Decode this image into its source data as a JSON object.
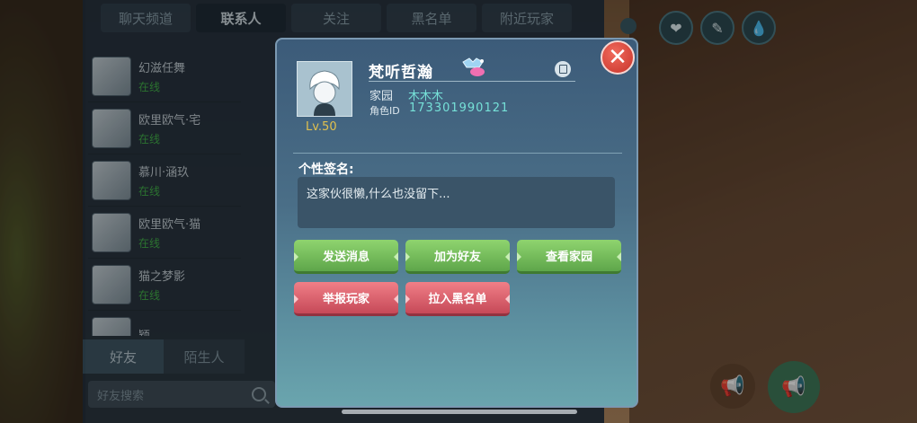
{
  "contacts_panel": {
    "top_tabs": [
      "聊天频道",
      "联系人",
      "关注",
      "黑名单",
      "附近玩家"
    ],
    "active_top_tab": 1,
    "friends": [
      {
        "name": "幻滋任舞",
        "status": "在线"
      },
      {
        "name": "欧里欧气·宅",
        "status": "在线"
      },
      {
        "name": "慕川·涵玖",
        "status": "在线"
      },
      {
        "name": "欧里欧气·猫",
        "status": "在线"
      },
      {
        "name": "猫之梦影",
        "status": "在线"
      },
      {
        "name": "颖",
        "status": ""
      }
    ],
    "bottom_tabs": [
      "好友",
      "陌生人"
    ],
    "search_placeholder": "好友搜索"
  },
  "profile": {
    "player_name": "梵听哲瀚",
    "level": "Lv.50",
    "home_label": "家园",
    "home_value": "木木木",
    "id_label": "角色ID",
    "id_value": "173301990121",
    "signature_label": "个性签名:",
    "signature_text": "这家伙很懒,什么也没留下...",
    "buttons": {
      "send_message": "发送消息",
      "add_friend": "加为好友",
      "view_home": "查看家园",
      "report_player": "举报玩家",
      "add_blacklist": "拉入黑名单"
    },
    "close_glyph": "✕"
  },
  "hud": {
    "heart_glyph": "❤",
    "chat_glyph": "✎",
    "drop_glyph": "💧",
    "megaphone_glyph": "📢"
  },
  "colors": {
    "accent_teal": "#76e1d8",
    "level_gold": "#e0c04e",
    "green_button": "#5ea64a",
    "red_button": "#c64958",
    "close_red": "#c7332a"
  }
}
